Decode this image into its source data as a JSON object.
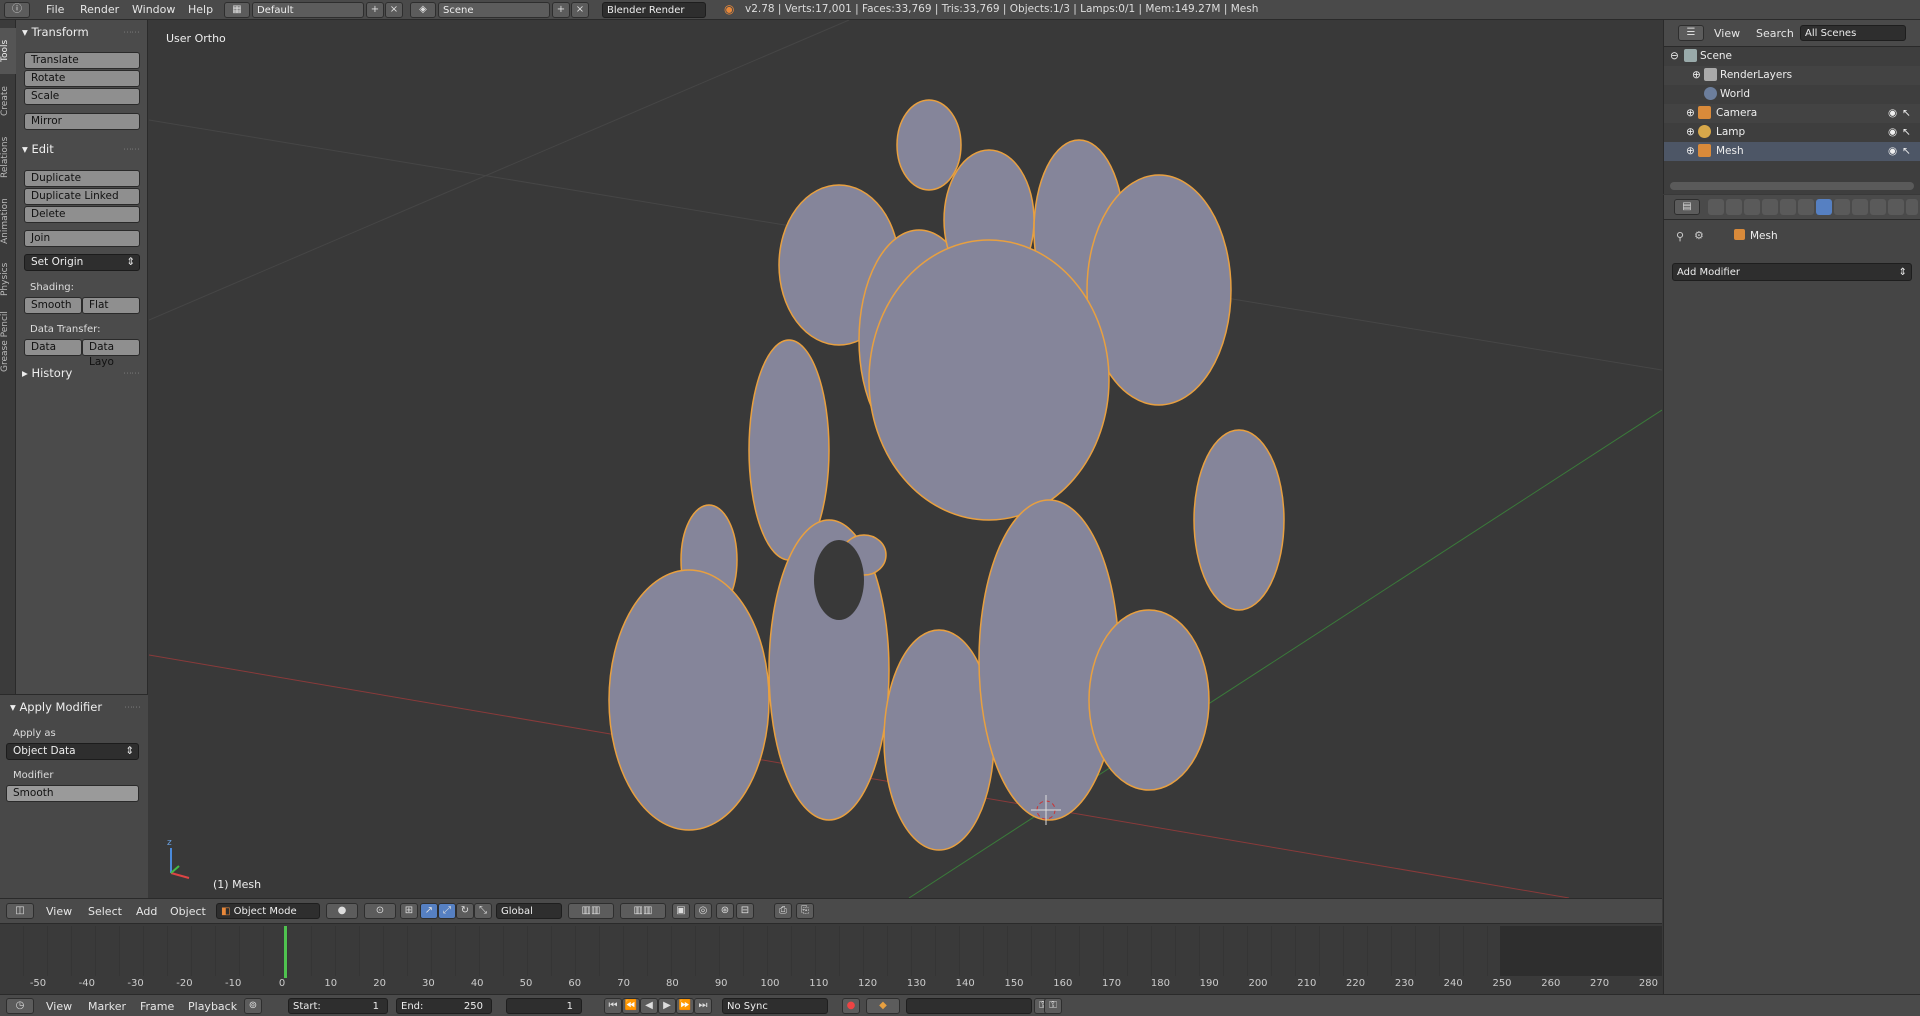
{
  "topbar": {
    "menus": [
      "File",
      "Render",
      "Window",
      "Help"
    ],
    "screen_layout": "Default",
    "scene": "Scene",
    "render_engine": "Blender Render",
    "stats": "v2.78 | Verts:17,001 | Faces:33,769 | Tris:33,769 | Objects:1/3 | Lamps:0/1 | Mem:149.27M | Mesh"
  },
  "tabs": [
    "Tools",
    "Create",
    "Relations",
    "Animation",
    "Physics",
    "Grease Pencil"
  ],
  "shelf": {
    "transform_header": "Transform",
    "translate": "Translate",
    "rotate": "Rotate",
    "scale": "Scale",
    "mirror": "Mirror",
    "edit_header": "Edit",
    "duplicate": "Duplicate",
    "duplicate_linked": "Duplicate Linked",
    "delete": "Delete",
    "join": "Join",
    "set_origin": "Set Origin",
    "shading_label": "Shading:",
    "smooth": "Smooth",
    "flat": "Flat",
    "data_transfer_label": "Data Transfer:",
    "data": "Data",
    "data_layout": "Data Layo",
    "history_header": "History",
    "apply_modifier_header": "Apply Modifier",
    "apply_as_label": "Apply as",
    "apply_as_value": "Object Data",
    "modifier_label": "Modifier",
    "modifier_value": "Smooth"
  },
  "viewport": {
    "title": "User Ortho",
    "object_label": "(1) Mesh"
  },
  "vp_header": {
    "menus": [
      "View",
      "Select",
      "Add",
      "Object"
    ],
    "mode": "Object Mode",
    "orientation": "Global"
  },
  "timeline": {
    "ticks": [
      "-50",
      "-40",
      "-30",
      "-20",
      "-10",
      "0",
      "10",
      "20",
      "30",
      "40",
      "50",
      "60",
      "70",
      "80",
      "90",
      "100",
      "110",
      "120",
      "130",
      "140",
      "150",
      "160",
      "170",
      "180",
      "190",
      "200",
      "210",
      "220",
      "230",
      "240",
      "250",
      "260",
      "270",
      "280"
    ],
    "current_frame_marker": 0,
    "menus": [
      "View",
      "Marker",
      "Frame",
      "Playback"
    ],
    "start_label": "Start:",
    "start_value": "1",
    "end_label": "End:",
    "end_value": "250",
    "current_value": "1",
    "sync": "No Sync"
  },
  "outliner": {
    "view": "View",
    "search": "Search",
    "filter": "All Scenes",
    "items": [
      "Scene",
      "RenderLayers",
      "World",
      "Camera",
      "Lamp",
      "Mesh"
    ]
  },
  "properties": {
    "breadcrumb_object": "Mesh",
    "add_modifier": "Add Modifier"
  },
  "colors": {
    "selection_outline": "#e8a040",
    "mesh": "#8b8b99",
    "active_tab": "#5680c2",
    "frame_marker": "#4fc24f"
  }
}
